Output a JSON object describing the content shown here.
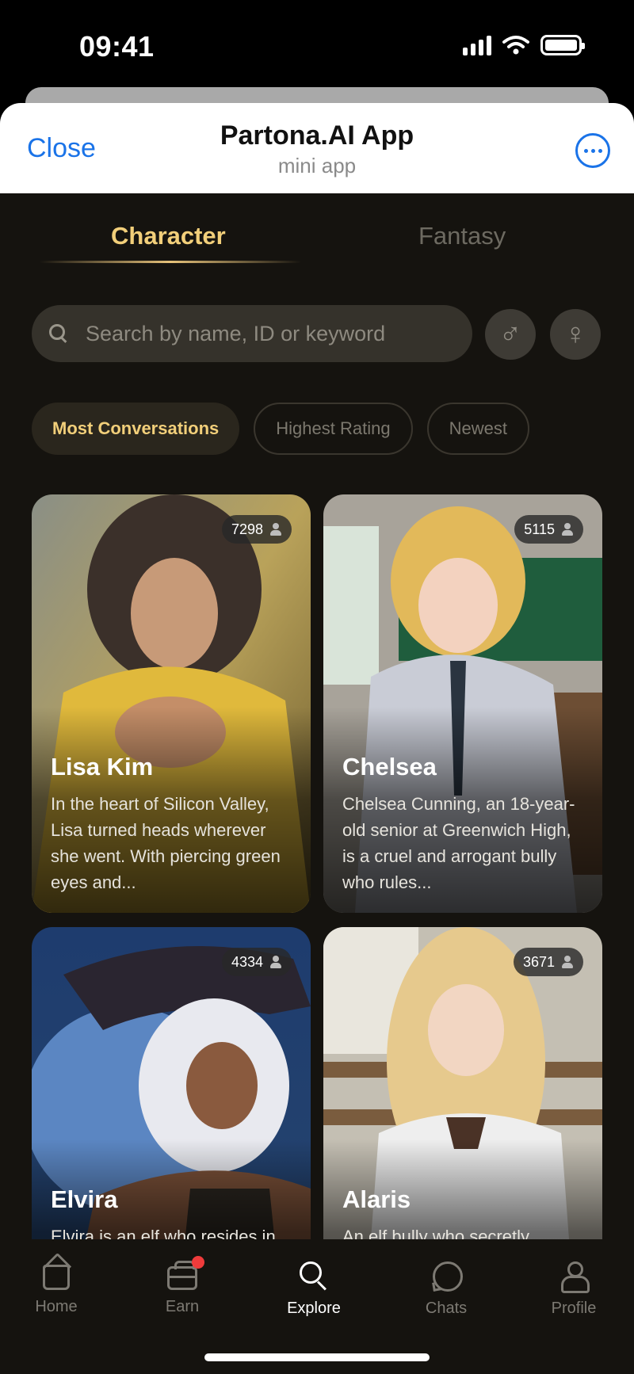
{
  "status_bar": {
    "time": "09:41"
  },
  "header": {
    "close_label": "Close",
    "title": "Partona.AI App",
    "subtitle": "mini app"
  },
  "tabs": [
    {
      "label": "Character",
      "active": true
    },
    {
      "label": "Fantasy",
      "active": false
    }
  ],
  "search": {
    "placeholder": "Search by name, ID or keyword",
    "value": ""
  },
  "gender_filters": [
    {
      "icon": "male-icon",
      "glyph": "♂"
    },
    {
      "icon": "female-icon",
      "glyph": "♀"
    }
  ],
  "sort_filters": [
    {
      "label": "Most Conversations",
      "active": true
    },
    {
      "label": "Highest Rating",
      "active": false
    },
    {
      "label": "Newest",
      "active": false
    }
  ],
  "characters": [
    {
      "name": "Lisa Kim",
      "count": "7298",
      "description": "In the heart of Silicon Valley, Lisa turned heads wherever she went. With piercing green eyes and..."
    },
    {
      "name": "Chelsea",
      "count": "5115",
      "description": "Chelsea Cunning, an 18-year-old senior at Greenwich High, is a cruel and arrogant bully who rules..."
    },
    {
      "name": "Elvira",
      "count": "4334",
      "description": "Elvira is an elf who resides in"
    },
    {
      "name": "Alaris",
      "count": "3671",
      "description": "An elf bully who secretly"
    }
  ],
  "bottom_nav": [
    {
      "label": "Home",
      "active": false
    },
    {
      "label": "Earn",
      "active": false,
      "badge": true
    },
    {
      "label": "Explore",
      "active": true
    },
    {
      "label": "Chats",
      "active": false
    },
    {
      "label": "Profile",
      "active": false
    }
  ],
  "colors": {
    "accent_gold": "#f2cf7a",
    "link_blue": "#1a73e8",
    "background": "#15130f",
    "badge_red": "#ef3b3b"
  }
}
